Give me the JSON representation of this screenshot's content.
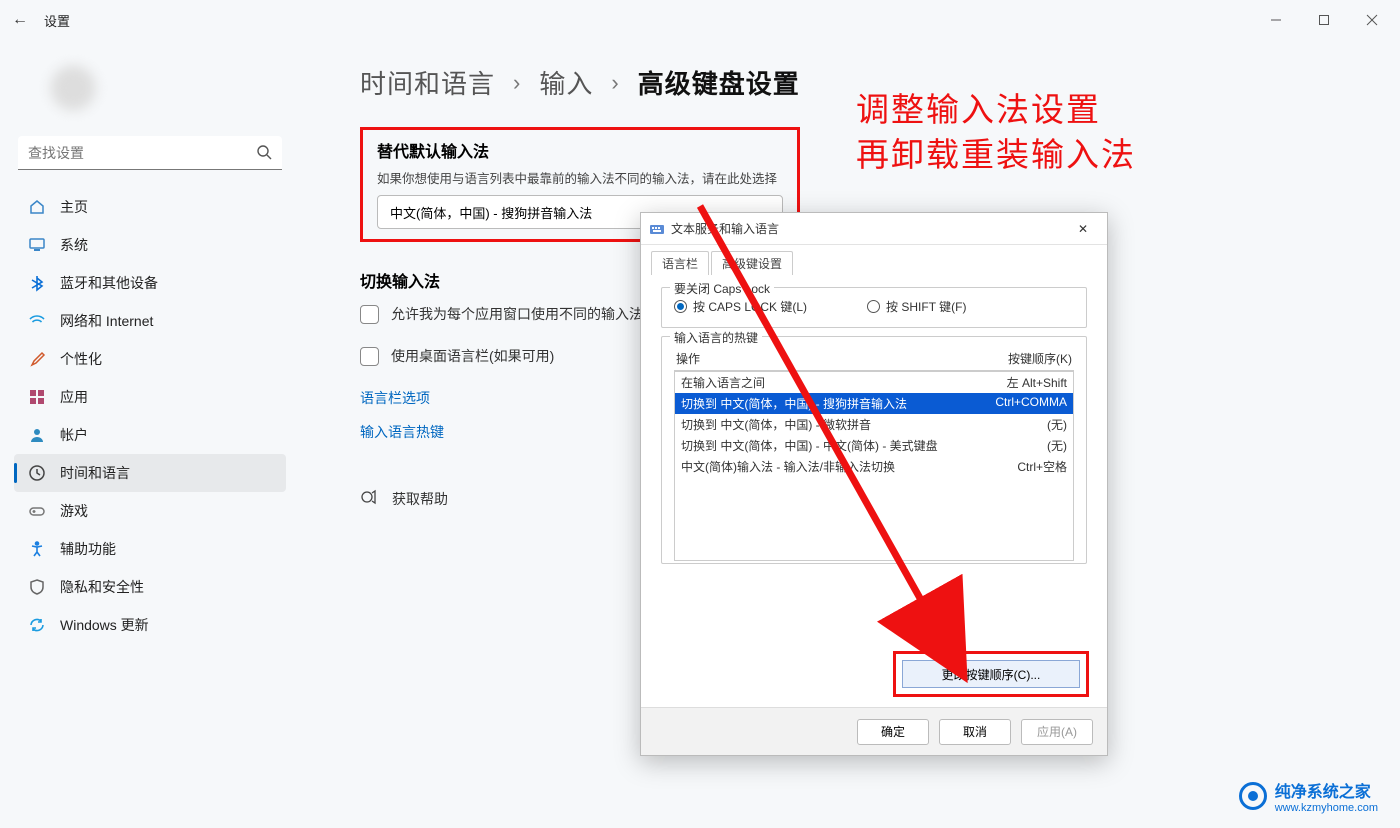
{
  "window": {
    "title": "设置"
  },
  "search": {
    "placeholder": "查找设置"
  },
  "nav": [
    {
      "label": "主页",
      "icon": "home",
      "color": "#3a86c8"
    },
    {
      "label": "系统",
      "icon": "system",
      "color": "#3a86c8"
    },
    {
      "label": "蓝牙和其他设备",
      "icon": "bluetooth",
      "color": "#0a6fd6"
    },
    {
      "label": "网络和 Internet",
      "icon": "wifi",
      "color": "#1a9be0"
    },
    {
      "label": "个性化",
      "icon": "brush",
      "color": "#d05a2c"
    },
    {
      "label": "应用",
      "icon": "apps",
      "color": "#b0496f"
    },
    {
      "label": "帐户",
      "icon": "account",
      "color": "#2e8bc0"
    },
    {
      "label": "时间和语言",
      "icon": "time",
      "color": "#444",
      "active": true
    },
    {
      "label": "游戏",
      "icon": "game",
      "color": "#777"
    },
    {
      "label": "辅助功能",
      "icon": "access",
      "color": "#1a7fe0"
    },
    {
      "label": "隐私和安全性",
      "icon": "privacy",
      "color": "#666"
    },
    {
      "label": "Windows 更新",
      "icon": "update",
      "color": "#1a9be0"
    }
  ],
  "breadcrumb": {
    "a": "时间和语言",
    "b": "输入",
    "c": "高级键盘设置"
  },
  "override": {
    "title": "替代默认输入法",
    "desc": "如果你想使用与语言列表中最靠前的输入法不同的输入法，请在此处选择",
    "value": "中文(简体，中国) - 搜狗拼音输入法"
  },
  "switch": {
    "title": "切换输入法",
    "chk1": "允许我为每个应用窗口使用不同的输入法",
    "chk2": "使用桌面语言栏(如果可用)",
    "link1": "语言栏选项",
    "link2": "输入语言热键"
  },
  "help": {
    "label": "获取帮助"
  },
  "annotation": {
    "l1": "调整输入法设置",
    "l2": "再卸载重装输入法"
  },
  "dialog": {
    "title": "文本服务和输入语言",
    "tab1": "语言栏",
    "tab2": "高级键设置",
    "caps_legend": "要关闭 Caps Lock",
    "r1": "按 CAPS LOCK 键(L)",
    "r2": "按 SHIFT 键(F)",
    "hot_legend": "输入语言的热键",
    "col1": "操作",
    "col2": "按键顺序(K)",
    "rows": [
      {
        "a": "在输入语言之间",
        "b": "左 Alt+Shift"
      },
      {
        "a": "切换到 中文(简体，中国) - 搜狗拼音输入法",
        "b": "Ctrl+COMMA",
        "sel": true
      },
      {
        "a": "切换到 中文(简体，中国) - 微软拼音",
        "b": "(无)"
      },
      {
        "a": "切换到 中文(简体，中国) - 中文(简体) - 美式键盘",
        "b": "(无)"
      },
      {
        "a": "中文(简体)输入法 - 输入法/非输入法切换",
        "b": "Ctrl+空格"
      }
    ],
    "changebtn": "更改按键顺序(C)...",
    "ok": "确定",
    "cancel": "取消",
    "apply": "应用(A)"
  },
  "watermark": {
    "name": "纯净系统之家",
    "url": "www.kzmyhome.com"
  }
}
